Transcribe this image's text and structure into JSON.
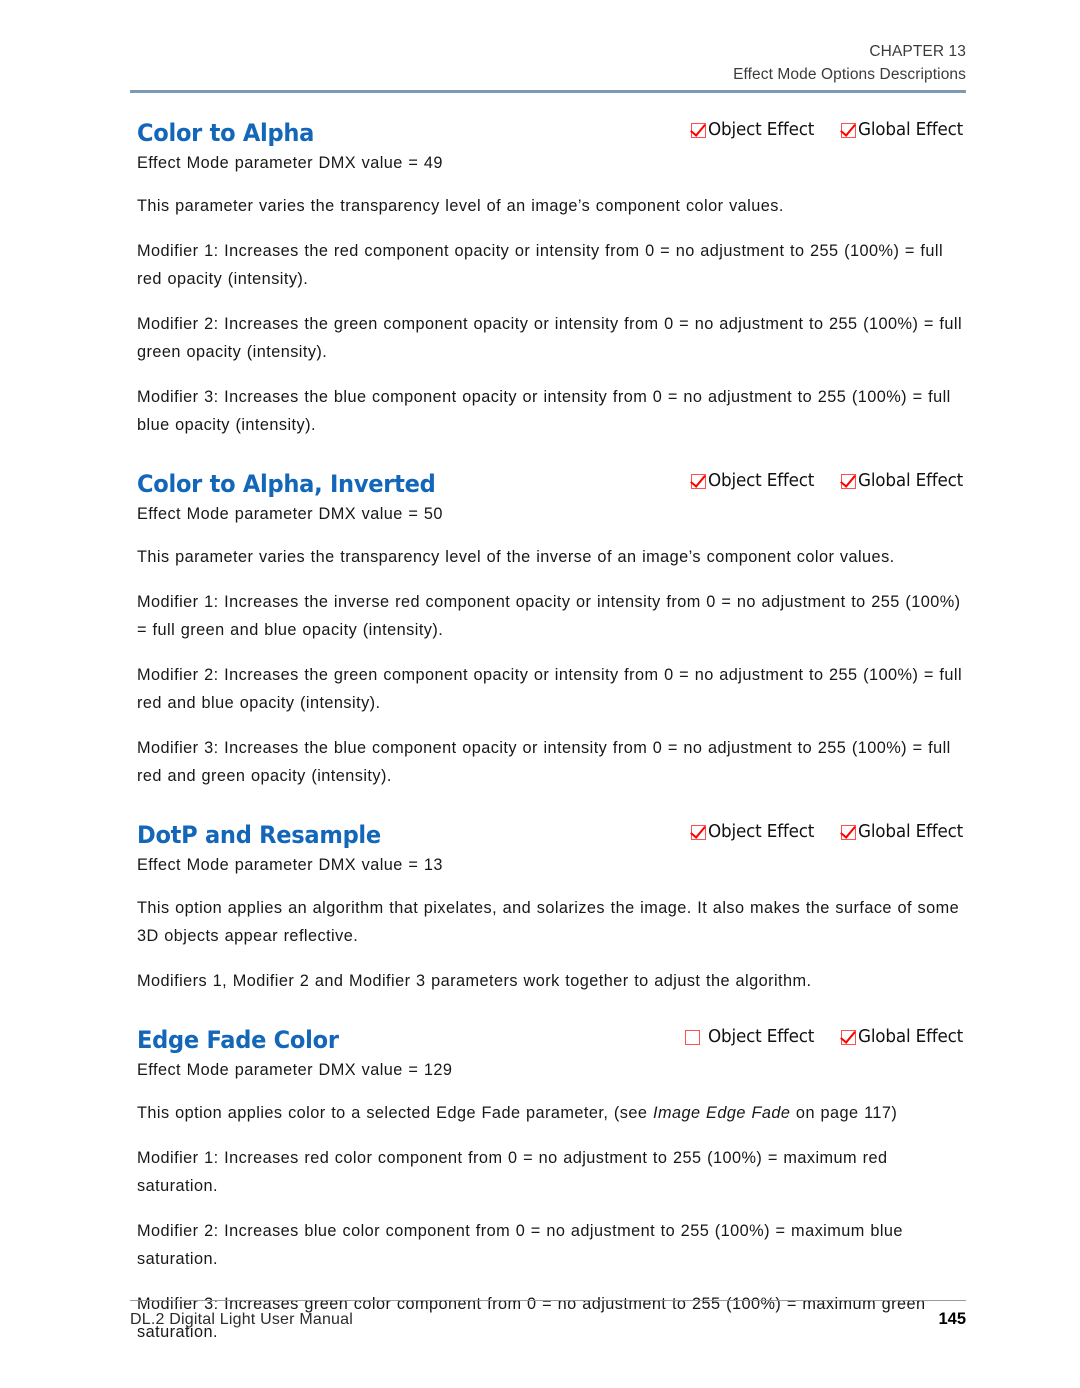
{
  "header": {
    "chapter": "CHAPTER 13",
    "subtitle": "Effect Mode Options Descriptions"
  },
  "colors": {
    "heading_blue": "#1366b8",
    "rule_blue": "#7d9ab5",
    "checkbox_red": "#ff5050",
    "check_red": "#ff0000"
  },
  "flag_labels": {
    "object_effect": "Object Effect",
    "global_effect": "Global Effect"
  },
  "sections": [
    {
      "title": "Color to Alpha",
      "object_effect_checked": true,
      "global_effect_checked": true,
      "dmx_line": "Effect Mode parameter DMX value =  49",
      "description": "This parameter varies the transparency level of an image’s component color values.",
      "modifiers": [
        "Modifier 1: Increases the red component opacity or intensity from 0 = no adjustment to 255 (100%) = full red opacity (intensity).",
        "Modifier 2: Increases the green component opacity or intensity from 0 = no adjustment to 255 (100%) = full green opacity (intensity).",
        "Modifier 3: Increases the blue component opacity or intensity from 0 = no adjustment to 255 (100%) = full blue opacity (intensity)."
      ]
    },
    {
      "title": "Color to Alpha, Inverted",
      "object_effect_checked": true,
      "global_effect_checked": true,
      "dmx_line": "Effect Mode parameter DMX value =  50",
      "description": "This parameter varies the transparency level of the inverse of an image’s component color values.",
      "modifiers": [
        "Modifier 1: Increases the inverse red component opacity or intensity from 0 = no adjustment to 255 (100%) = full green and blue opacity (intensity).",
        "Modifier 2: Increases the green component opacity or intensity from 0 = no adjustment to 255 (100%) = full red and blue opacity (intensity).",
        "Modifier 3: Increases the blue component opacity or intensity from 0 = no adjustment to 255 (100%) = full red and green opacity (intensity)."
      ]
    },
    {
      "title": "DotP and Resample",
      "object_effect_checked": true,
      "global_effect_checked": true,
      "dmx_line": "Effect Mode parameter DMX value =  13",
      "description": "This option applies an algorithm that pixelates, and solarizes the image. It also makes the surface of some 3D objects appear reflective.",
      "modifiers": [
        "Modifiers 1, Modifier 2 and Modifier 3 parameters work together to adjust the algorithm."
      ]
    },
    {
      "title": "Edge Fade Color",
      "object_effect_checked": false,
      "global_effect_checked": true,
      "dmx_line": "Effect Mode parameter DMX value =  129",
      "description_pre": "This option applies color to a selected Edge Fade parameter, (see ",
      "description_italic": "Image Edge Fade",
      "description_post": " on page 117)",
      "modifiers": [
        "Modifier 1: Increases red color component from 0 = no adjustment to 255 (100%) = maximum red saturation.",
        "Modifier 2: Increases blue color component from 0 = no adjustment to 255 (100%) = maximum blue saturation.",
        "Modifier 3: Increases green color component from 0 = no adjustment to 255 (100%) = maximum green saturation."
      ]
    }
  ],
  "footer": {
    "manual_title": "DL.2 Digital Light User Manual",
    "page_number": "145"
  }
}
